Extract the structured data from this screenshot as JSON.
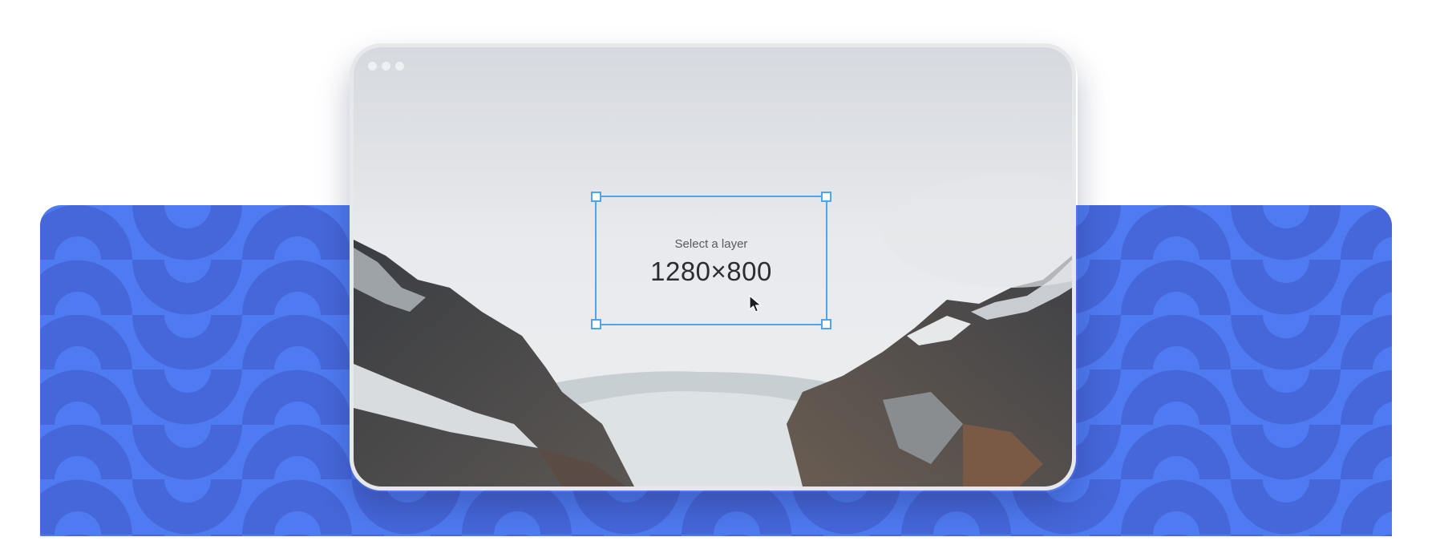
{
  "selection": {
    "label": "Select a layer",
    "size": "1280×800"
  },
  "colors": {
    "banner": "#4f7bf2",
    "pattern": "#4667d9",
    "selection": "#4aa6f0"
  },
  "icons": {
    "window_controls": "traffic-light-dots",
    "cursor": "arrow-cursor-icon"
  }
}
